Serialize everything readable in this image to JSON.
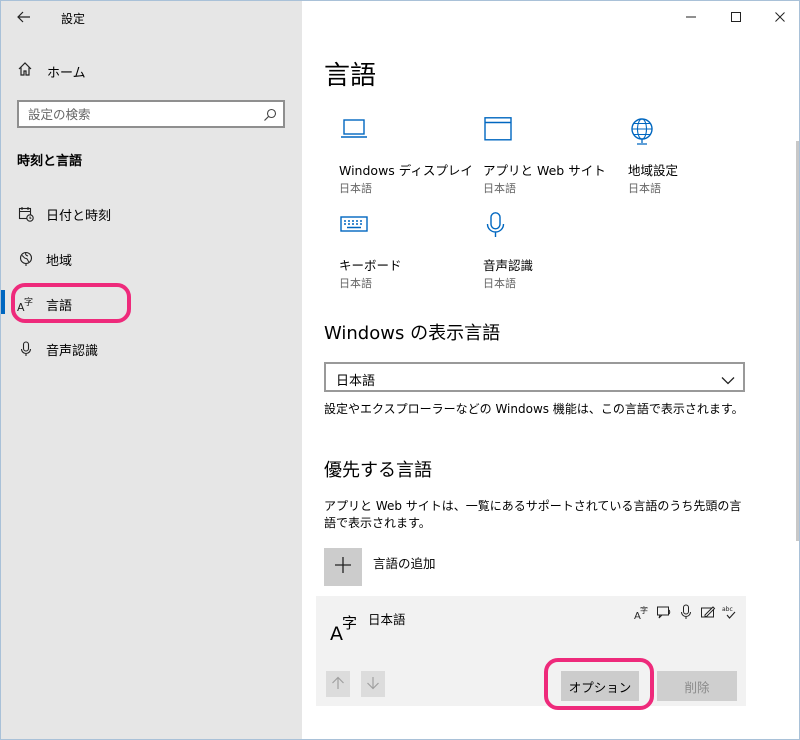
{
  "window": {
    "title": "設定",
    "highlight_color": "#ee2a7b",
    "accent_color": "#0067c0",
    "controls": [
      "minimize-icon",
      "maximize-icon",
      "close-icon"
    ]
  },
  "sidebar": {
    "home_label": "ホーム",
    "search_placeholder": "設定の検索",
    "section_title": "時刻と言語",
    "items": [
      {
        "label": "日付と時刻",
        "icon": "date-time-icon"
      },
      {
        "label": "地域",
        "icon": "region-icon"
      },
      {
        "label": "言語",
        "icon": "language-icon",
        "selected": true
      },
      {
        "label": "音声認識",
        "icon": "microphone-icon"
      }
    ]
  },
  "main": {
    "title": "言語",
    "related": [
      {
        "name": "Windows ディスプレイ",
        "sub": "日本語",
        "icon": "laptop-icon"
      },
      {
        "name": "アプリと Web サイト",
        "sub": "日本語",
        "icon": "browser-window-icon"
      },
      {
        "name": "地域設定",
        "sub": "日本語",
        "icon": "globe-icon"
      },
      {
        "name": "キーボード",
        "sub": "日本語",
        "icon": "keyboard-icon"
      },
      {
        "name": "音声認識",
        "sub": "日本語",
        "icon": "microphone-icon"
      }
    ],
    "display_language": {
      "heading": "Windows の表示言語",
      "selected": "日本語",
      "description": "設定やエクスプローラーなどの Windows 機能は、この言語で表示されます。"
    },
    "preferred": {
      "heading": "優先する言語",
      "description": "アプリと Web サイトは、一覧にあるサポートされている言語のうち先頭の言語で表示されます。",
      "add_label": "言語の追加",
      "language": {
        "name": "日本語",
        "capabilities": [
          "display-language-icon",
          "text-to-speech-icon",
          "speech-recognition-icon",
          "handwriting-icon",
          "spellcheck-icon"
        ],
        "options_label": "オプション",
        "remove_label": "削除"
      }
    }
  }
}
